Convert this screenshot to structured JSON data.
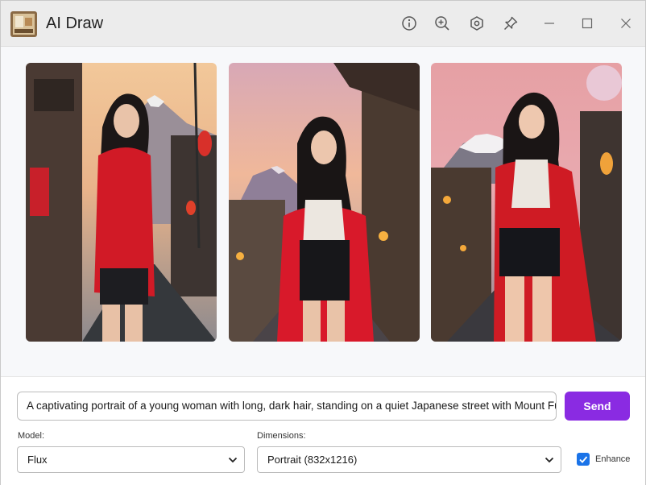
{
  "window": {
    "title": "AI Draw"
  },
  "toolbar": {
    "icons": [
      "info-icon",
      "zoom-in-icon",
      "settings-icon",
      "pin-icon"
    ],
    "window_controls": [
      "minimize-icon",
      "maximize-icon",
      "close-icon"
    ]
  },
  "gallery": {
    "images": [
      {
        "alt": "Woman in red coat on Japanese street with Mount Fuji (1)"
      },
      {
        "alt": "Woman in red coat on Japanese street with Mount Fuji (2)"
      },
      {
        "alt": "Woman in red coat on Japanese street with Mount Fuji (3)"
      }
    ]
  },
  "prompt": {
    "value": "A captivating portrait of a young woman with long, dark hair, standing on a quiet Japanese street with Mount Fuji"
  },
  "send": {
    "label": "Send"
  },
  "model": {
    "label": "Model:",
    "value": "Flux"
  },
  "dimensions": {
    "label": "Dimensions:",
    "value": "Portrait (832x1216)"
  },
  "enhance": {
    "label": "Enhance",
    "checked": true
  },
  "colors": {
    "accent": "#8a2be2",
    "checkbox": "#1a73e8"
  }
}
